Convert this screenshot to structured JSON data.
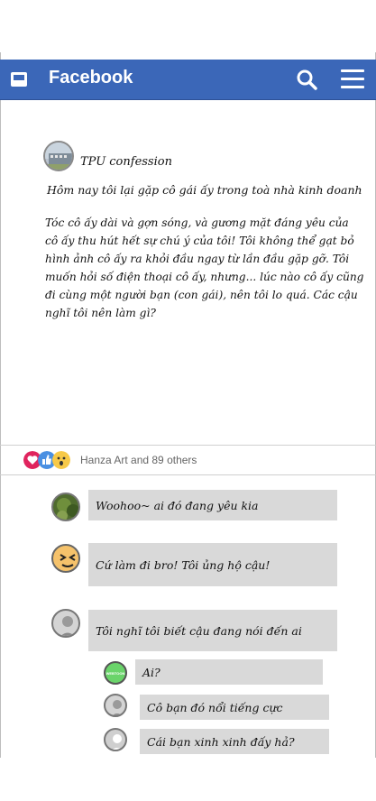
{
  "app": {
    "brand": "Facebook",
    "brand_color": "#3b67b8",
    "icons": [
      "window-icon",
      "search-icon",
      "menu-icon"
    ]
  },
  "post": {
    "page_name": "TPU confession",
    "title": "Hôm nay tôi lại gặp cô gái ấy trong toà nhà kinh doanh",
    "body": "Tóc cô ấy dài và gợn sóng, và gương mặt đáng yêu của cô ấy thu hút hết sự chú ý của tôi! Tôi không thể gạt bỏ hình ảnh cô ấy ra khỏi đầu ngay từ lần đầu gặp gỡ. Tôi muốn hỏi số điện thoại cô ấy, nhưng... lúc nào cô ấy cũng đi cùng một người bạn (con gái), nên tôi lo quá. Các cậu nghĩ tôi nên làm gì?"
  },
  "reactions": {
    "summary": "Hanza Art and 89 others",
    "icons": [
      "heart-icon",
      "like-icon",
      "wow-icon"
    ]
  },
  "comments": [
    {
      "text": "Woohoo~ ai đó đang yêu kia",
      "avatar": "plant-avatar"
    },
    {
      "text": "Cứ làm đi bro! Tôi ủng hộ cậu!",
      "avatar": "emoji-avatar"
    },
    {
      "text": "Tôi nghĩ tôi biết cậu đang nói đến ai",
      "avatar": "person-avatar"
    }
  ],
  "replies": [
    {
      "text": "Ai?",
      "avatar_label": "WEBTOON"
    },
    {
      "text": "Cô bạn đó nổi tiếng cực",
      "avatar": "person-avatar"
    },
    {
      "text": "Cái bạn xinh xinh đấy hả?",
      "avatar": "default-avatar"
    }
  ]
}
